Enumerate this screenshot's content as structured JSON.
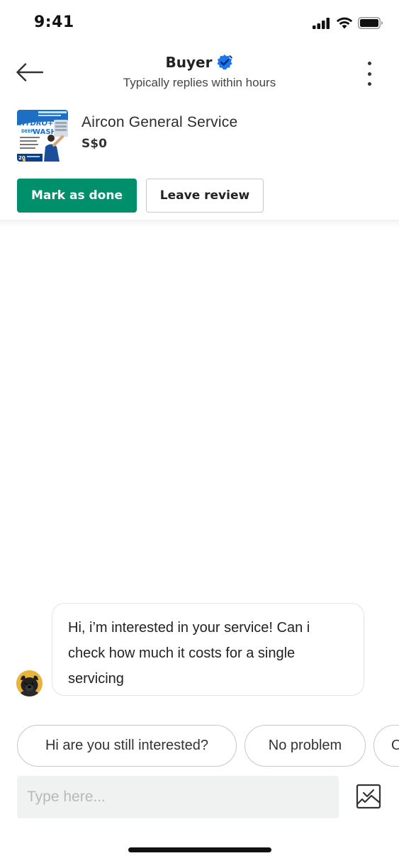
{
  "status_bar": {
    "time": "9:41",
    "icons": [
      "cellular-signal-icon",
      "wifi-icon",
      "battery-icon"
    ]
  },
  "header": {
    "back_icon": "arrow-left-icon",
    "title": "Buyer",
    "verified_icon": "verified-badge-icon",
    "subtitle": "Typically replies within hours",
    "more_icon": "more-vertical-icon"
  },
  "listing": {
    "name": "Aircon General Service",
    "price": "S$0",
    "thumbnail": {
      "banner_text": "HYDRO+ DEEP WASH",
      "badge_text": "20"
    }
  },
  "actions": {
    "mark_done_label": "Mark as done",
    "leave_review_label": "Leave review"
  },
  "messages": [
    {
      "text": "Hi, i’m interested in your service! Can i check how much it costs for a single servicing",
      "avatar_icon": "dog-avatar-icon"
    }
  ],
  "quick_replies": [
    "Hi are you still interested?",
    "No problem",
    "O"
  ],
  "composer": {
    "placeholder": "Type here...",
    "value": "",
    "image_icon": "image-upload-icon"
  },
  "colors": {
    "primary": "#008f6b",
    "verified": "#1877f2",
    "input_bg": "#f0f1f1"
  }
}
